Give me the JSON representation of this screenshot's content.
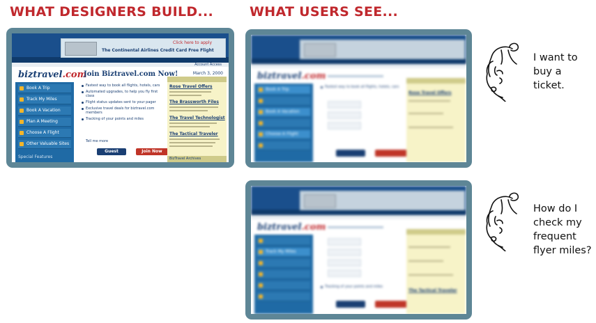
{
  "headings": {
    "left": "WHAT DESIGNERS BUILD...",
    "right": "WHAT USERS SEE..."
  },
  "site": {
    "logo_text": "biztravel",
    "logo_suffix": ".com",
    "banner_tag": "Click here to apply",
    "banner_text": "The Continental Airlines Credit Card Free Flight",
    "top_link": "Account Access",
    "date": "March 3, 2000",
    "join_title": "Join Biztravel.com Now!",
    "sidebar_items": [
      "Book A Trip",
      "Track My Miles",
      "Book A Vacation",
      "Plan A Meeting",
      "Choose A Flight",
      "Other Valuable Sites"
    ],
    "sidebar_footer": "Special Features",
    "bullets": [
      "Fastest way to book all flights, hotels, cars",
      "Automated upgrades, to help you fly first class",
      "Flight status updates sent to your pager",
      "Exclusive travel deals for biztravel.com members",
      "Tracking of your points and miles"
    ],
    "tell_more": "Tell me more",
    "go_button": "Guest",
    "join_button": "Join Now",
    "right_titles": [
      "Rose Travel Offers",
      "The Brassworth Files",
      "The Travel Technologist",
      "The Tactical Traveler"
    ],
    "right_footer": "BizTravel Archives"
  },
  "blur_screens": {
    "top": {
      "question": [
        "I want to",
        "buy a",
        "ticket."
      ]
    },
    "bottom": {
      "question": [
        "How do I",
        "check my",
        "frequent",
        "flyer miles?"
      ],
      "visible_sidebar": "Track My Miles",
      "visible_bullet": "Tracking of your points and miles",
      "visible_right": "The Tactical Traveler"
    },
    "top_visible": {
      "sidebar": "Book A Trip",
      "sidebar2": "Book A Vacation",
      "sidebar3": "Choose A Flight",
      "bullet": "Fastest way to book all flights, hotels, cars",
      "right": "Rose Travel Offers"
    }
  },
  "colors": {
    "accent_red": "#c0282d",
    "frame": "#5e8696",
    "site_blue": "#1a3f73"
  },
  "icons": [
    "woman-face-icon",
    "woman-face-icon"
  ]
}
